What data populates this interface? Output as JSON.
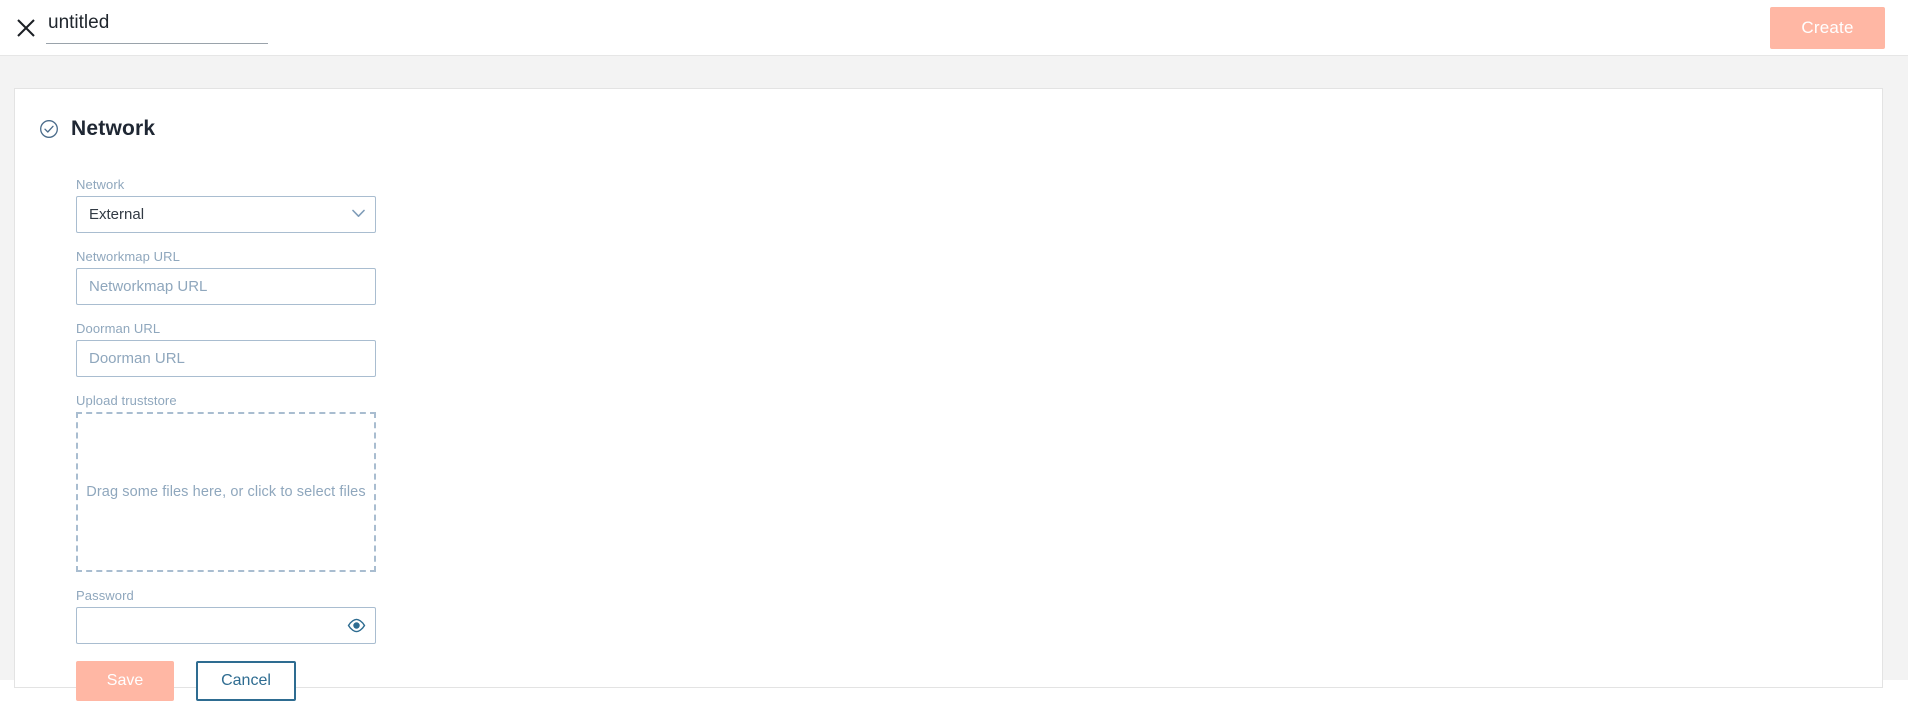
{
  "topbar": {
    "close_icon": "close-icon",
    "title_value": "untitled",
    "title_placeholder": "untitled",
    "create_label": "Create"
  },
  "section": {
    "status_icon": "check-circle-icon",
    "title": "Network"
  },
  "form": {
    "network": {
      "label": "Network",
      "selected": "External",
      "options": [
        "External"
      ],
      "chevron_icon": "chevron-down-icon"
    },
    "networkmap_url": {
      "label": "Networkmap URL",
      "value": "",
      "placeholder": "Networkmap URL"
    },
    "doorman_url": {
      "label": "Doorman URL",
      "value": "",
      "placeholder": "Doorman URL"
    },
    "upload_truststore": {
      "label": "Upload truststore",
      "dropzone_text": "Drag some files here, or click to select files"
    },
    "password": {
      "label": "Password",
      "value": "",
      "placeholder": "",
      "reveal_icon": "eye-icon"
    }
  },
  "actions": {
    "save_label": "Save",
    "cancel_label": "Cancel"
  },
  "colors": {
    "accent_peach": "#ffb7a4",
    "border_blue": "#a9bdd0",
    "label_blue": "#8fa7bd",
    "cancel_blue": "#2e6c91",
    "page_bg": "#f3f3f3",
    "title_dark": "#1f2733"
  }
}
